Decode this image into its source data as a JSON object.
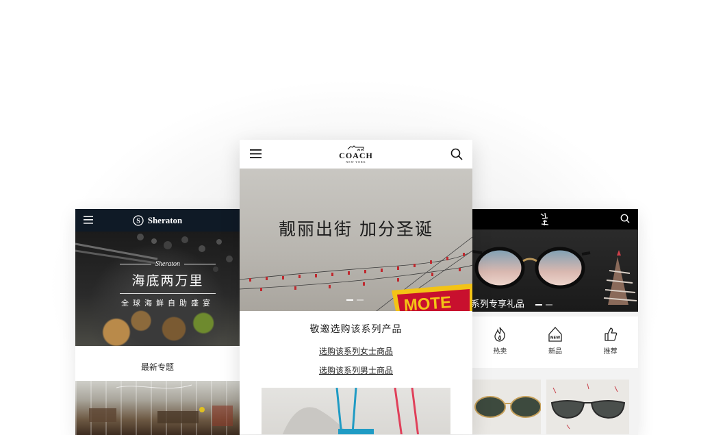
{
  "left": {
    "brand": "Sheraton",
    "hero_brand": "Sheraton",
    "hero_title": "海底两万里",
    "hero_sub": "全球海鲜自助盛宴",
    "section_title": "最新专题"
  },
  "center": {
    "brand": "COACH",
    "brand_sub": "NEW YORK",
    "hero_title": "靓丽出街 加分圣诞",
    "sign_text": "MOTE",
    "promo_heading": "敬邀选购该系列产品",
    "link_women": "选购该系列女士商品",
    "link_men": "选购该系列男士商品"
  },
  "right": {
    "hero_caption": "系列专享礼品",
    "icons": [
      {
        "label": "热卖",
        "icon": "flame-icon"
      },
      {
        "label": "新品",
        "icon": "new-tag-icon",
        "tag": "NEW"
      },
      {
        "label": "推荐",
        "icon": "thumbs-up-icon"
      }
    ]
  },
  "colors": {
    "sheraton_header": "#0f1a26",
    "right_header": "#000000",
    "sign_red": "#c8102e",
    "sign_yellow": "#f3c316",
    "bag_teal": "#1f9bc4",
    "strap_red": "#e0405a"
  }
}
